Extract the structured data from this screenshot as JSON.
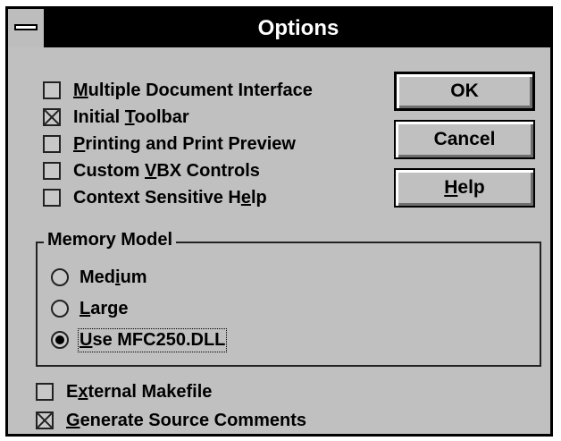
{
  "window": {
    "title": "Options"
  },
  "options": [
    {
      "pre": "",
      "key": "M",
      "post": "ultiple Document Interface",
      "checked": false
    },
    {
      "pre": "Initial ",
      "key": "T",
      "post": "oolbar",
      "checked": true
    },
    {
      "pre": "",
      "key": "P",
      "post": "rinting and Print Preview",
      "checked": false
    },
    {
      "pre": "Custom ",
      "key": "V",
      "post": "BX Controls",
      "checked": false
    },
    {
      "pre": "Context Sensitive H",
      "key": "e",
      "post": "lp",
      "checked": false
    }
  ],
  "buttons": {
    "ok": "OK",
    "cancel": "Cancel",
    "help_key": "H",
    "help_rest": "elp"
  },
  "memory_model": {
    "label": "Memory Model",
    "options": [
      {
        "pre": "Med",
        "key": "i",
        "post": "um",
        "selected": false
      },
      {
        "pre": "",
        "key": "L",
        "post": "arge",
        "selected": false
      },
      {
        "pre": "",
        "key": "U",
        "post": "se MFC250.DLL",
        "selected": true
      }
    ]
  },
  "bottom_options": [
    {
      "pre": "E",
      "key": "x",
      "post": "ternal Makefile",
      "checked": false
    },
    {
      "pre": "",
      "key": "G",
      "post": "enerate Source Comments",
      "checked": true
    }
  ],
  "icons": {
    "system_menu": "system-menu-icon"
  }
}
